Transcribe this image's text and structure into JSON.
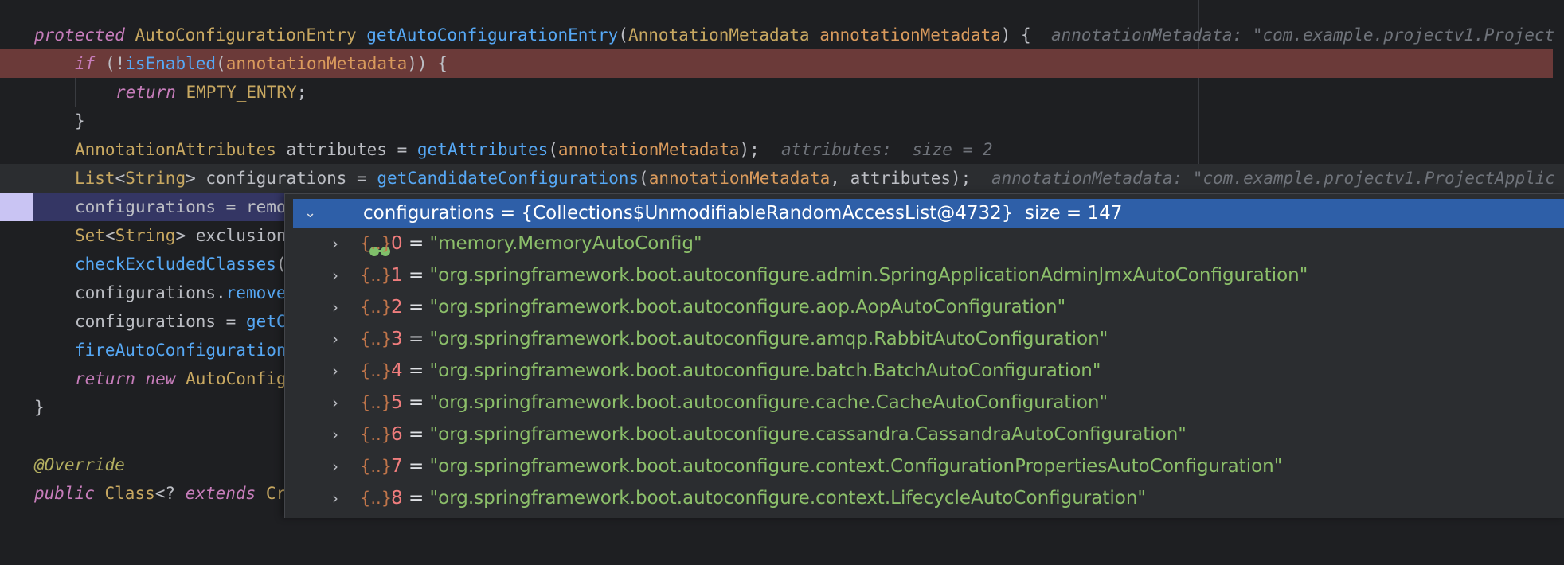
{
  "editor": {
    "lines": [
      {
        "id": "l1",
        "segments": [
          [
            "kw2",
            "protected "
          ],
          [
            "ty",
            "AutoConfigurationEntry "
          ],
          [
            "fn",
            "getAutoConfigurationEntry"
          ],
          [
            "plain",
            "("
          ],
          [
            "ty",
            "AnnotationMetadata "
          ],
          [
            "par",
            "annotationMetadata"
          ],
          [
            "plain",
            ") {  "
          ]
        ],
        "inline_hint": "annotationMetadata: \"com.example.projectv1.Project"
      },
      {
        "id": "l2",
        "segments": [
          [
            "kw2",
            "if "
          ],
          [
            "plain",
            "(!"
          ],
          [
            "fn",
            "isEnabled"
          ],
          [
            "plain",
            "("
          ],
          [
            "par",
            "annotationMetadata"
          ],
          [
            "plain",
            "))"
          ],
          [
            "plain",
            " {"
          ]
        ],
        "inline_hint": ""
      },
      {
        "id": "l3",
        "segments": [
          [
            "kw2",
            "return "
          ],
          [
            "ty",
            "EMPTY_ENTRY"
          ],
          [
            "plain",
            ";"
          ]
        ],
        "inline_hint": ""
      },
      {
        "id": "l4",
        "segments": [
          [
            "plain",
            "}"
          ]
        ],
        "inline_hint": ""
      },
      {
        "id": "l5",
        "segments": [
          [
            "ty",
            "AnnotationAttributes "
          ],
          [
            "plain",
            "attributes = "
          ],
          [
            "fn",
            "getAttributes"
          ],
          [
            "plain",
            "("
          ],
          [
            "par",
            "annotationMetadata"
          ],
          [
            "plain",
            ");  "
          ]
        ],
        "inline_hint": "attributes:  size = 2"
      },
      {
        "id": "l6",
        "segments": [
          [
            "ty",
            "List"
          ],
          [
            "plain",
            "<"
          ],
          [
            "ty",
            "String"
          ],
          [
            "plain",
            "> configurations = "
          ],
          [
            "fn",
            "getCandidateConfigurations"
          ],
          [
            "plain",
            "("
          ],
          [
            "par",
            "annotationMetadata"
          ],
          [
            "plain",
            ", attributes);  "
          ]
        ],
        "inline_hint": "annotationMetadata: \"com.example.projectv1.ProjectApplic"
      },
      {
        "id": "l7",
        "segments": [
          [
            "plain",
            "configurations = remo"
          ]
        ],
        "inline_hint": ""
      },
      {
        "id": "l8",
        "segments": [
          [
            "ty",
            "Set"
          ],
          [
            "plain",
            "<"
          ],
          [
            "ty",
            "String"
          ],
          [
            "plain",
            "> exclusion"
          ]
        ],
        "inline_hint": ""
      },
      {
        "id": "l9",
        "segments": [
          [
            "fn",
            "checkExcludedClasses"
          ],
          [
            "plain",
            "("
          ]
        ],
        "inline_hint": ""
      },
      {
        "id": "l10",
        "segments": [
          [
            "plain",
            "configurations."
          ],
          [
            "fn",
            "remove"
          ]
        ],
        "inline_hint": ""
      },
      {
        "id": "l11",
        "segments": [
          [
            "plain",
            "configurations = "
          ],
          [
            "fn",
            "getC"
          ]
        ],
        "inline_hint": ""
      },
      {
        "id": "l12",
        "segments": [
          [
            "fn",
            "fireAutoConfiguration"
          ]
        ],
        "inline_hint": ""
      },
      {
        "id": "l13",
        "segments": [
          [
            "kw2",
            "return new "
          ],
          [
            "ty",
            "AutoConfig"
          ]
        ],
        "inline_hint": ""
      },
      {
        "id": "l14",
        "segments": [
          [
            "plain",
            "}"
          ]
        ],
        "inline_hint": ""
      },
      {
        "id": "l15",
        "segments": [],
        "inline_hint": ""
      },
      {
        "id": "l16",
        "segments": [
          [
            "anno",
            "@Override"
          ]
        ],
        "inline_hint": ""
      },
      {
        "id": "l17",
        "segments": [
          [
            "kw2",
            "public "
          ],
          [
            "ty",
            "Class"
          ],
          [
            "plain",
            "<?"
          ],
          [
            "kw2",
            " extends "
          ],
          [
            "ty",
            "Cr"
          ]
        ],
        "inline_hint": ""
      }
    ]
  },
  "popup": {
    "header": "configurations = {Collections$UnmodifiableRandomAccessList@4732}  size = 147",
    "items": [
      {
        "index": "0",
        "value": "\"memory.MemoryAutoConfig\""
      },
      {
        "index": "1",
        "value": "\"org.springframework.boot.autoconfigure.admin.SpringApplicationAdminJmxAutoConfiguration\""
      },
      {
        "index": "2",
        "value": "\"org.springframework.boot.autoconfigure.aop.AopAutoConfiguration\""
      },
      {
        "index": "3",
        "value": "\"org.springframework.boot.autoconfigure.amqp.RabbitAutoConfiguration\""
      },
      {
        "index": "4",
        "value": "\"org.springframework.boot.autoconfigure.batch.BatchAutoConfiguration\""
      },
      {
        "index": "5",
        "value": "\"org.springframework.boot.autoconfigure.cache.CacheAutoConfiguration\""
      },
      {
        "index": "6",
        "value": "\"org.springframework.boot.autoconfigure.cassandra.CassandraAutoConfiguration\""
      },
      {
        "index": "7",
        "value": "\"org.springframework.boot.autoconfigure.context.ConfigurationPropertiesAutoConfiguration\""
      },
      {
        "index": "8",
        "value": "\"org.springframework.boot.autoconfigure.context.LifecycleAutoConfiguration\""
      }
    ],
    "item_icon": "object-braces-icon",
    "expand_icon": "chevron-right-icon"
  }
}
